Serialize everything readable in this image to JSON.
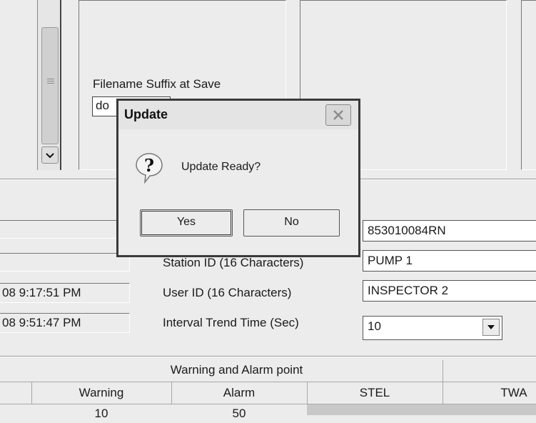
{
  "settings": {
    "filename_suffix_label": "Filename Suffix at Save",
    "filename_suffix_value": "do"
  },
  "info": {
    "serial_value": "853010084RN",
    "station_id_label": "Station ID (16 Characters)",
    "station_id_value": "PUMP 1",
    "user_id_label": "User ID (16 Characters)",
    "user_id_value": "INSPECTOR 2",
    "interval_label": "Interval Trend Time (Sec)",
    "interval_value": "10",
    "time1": "08 9:17:51 PM",
    "time2": "08 9:51:47 PM"
  },
  "table": {
    "group_header": "Warning and Alarm point",
    "columns": [
      "Warning",
      "Alarm",
      "STEL",
      "TWA"
    ],
    "row_values": [
      "10",
      "50"
    ]
  },
  "dialog": {
    "title": "Update",
    "message": "Update Ready?",
    "yes_label": "Yes",
    "no_label": "No"
  },
  "icons": {
    "dialog": "question-icon",
    "close": "close-icon",
    "scroll_down": "chevron-down-icon",
    "combo": "dropdown-arrow-icon"
  }
}
